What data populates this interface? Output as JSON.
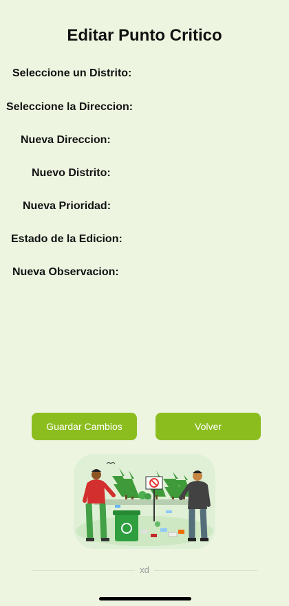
{
  "page": {
    "title": "Editar Punto Critico"
  },
  "form": {
    "distrito_label": "Seleccione un Distrito:",
    "direccion_label": "Seleccione la Direccion:",
    "nueva_direccion_label": "Nueva Direccion:",
    "nuevo_distrito_label": "Nuevo Distrito:",
    "nueva_prioridad_label": "Nueva Prioridad:",
    "estado_label": "Estado de la Edicion:",
    "observacion_label": "Nueva Observacion:"
  },
  "actions": {
    "save_label": "Guardar Cambios",
    "back_label": "Volver"
  },
  "footer": {
    "text": "xd"
  },
  "colors": {
    "background": "#edf5e1",
    "accent": "#8cbd1f",
    "button_text": "#ffffff"
  },
  "illustration": {
    "icon": "recycling-illustration-icon"
  }
}
